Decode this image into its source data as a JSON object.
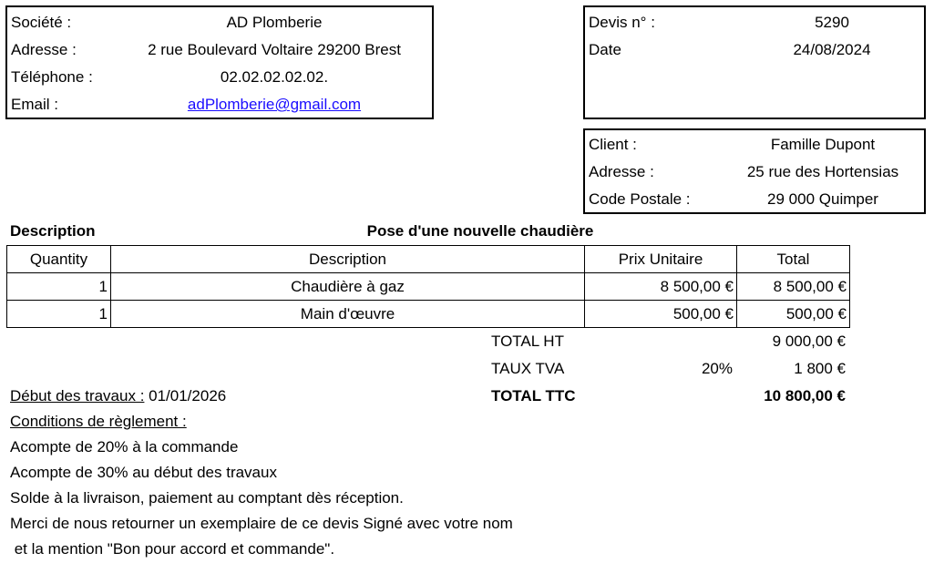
{
  "company": {
    "labels": {
      "societe": "Société :",
      "adresse": "Adresse :",
      "telephone": "Téléphone :",
      "email": "Email :"
    },
    "name": "AD Plomberie",
    "address": "2 rue Boulevard Voltaire  29200 Brest",
    "phone": "02.02.02.02.02.",
    "email": "adPlomberie@gmail.com"
  },
  "quote": {
    "labels": {
      "number": "Devis n° :",
      "date": "Date"
    },
    "number": "5290",
    "date": "24/08/2024"
  },
  "client": {
    "labels": {
      "client": "Client :",
      "adresse": "Adresse :",
      "postal": "Code Postale :"
    },
    "name": "Famille Dupont",
    "address": "25 rue des Hortensias",
    "postal": "29 000 Quimper"
  },
  "description": {
    "label": "Description",
    "title": "Pose d'une nouvelle chaudière"
  },
  "table": {
    "headers": [
      "Quantity",
      "Description",
      "Prix Unitaire",
      "Total"
    ],
    "rows": [
      [
        "1",
        "Chaudière à gaz",
        "8 500,00 €",
        "8 500,00 €"
      ],
      [
        "1",
        "Main d'œuvre",
        "500,00 €",
        "500,00 €"
      ]
    ]
  },
  "totals": {
    "ht_label": "TOTAL HT",
    "ht": "9 000,00 €",
    "tva_label": "TAUX TVA",
    "tva_rate": "20%",
    "tva": "1 800 €",
    "ttc_label": "TOTAL TTC",
    "ttc": "10 800,00 €"
  },
  "terms": {
    "start_label": "Début des travaux :",
    "start_date": " 01/01/2026",
    "conditions_label": "Conditions de règlement :",
    "lines": [
      "Acompte de 20% à la commande",
      "Acompte de 30% au début des travaux",
      "Solde à la livraison, paiement au comptant dès réception.",
      "Merci de nous retourner un exemplaire de ce devis Signé avec votre nom",
      " et la mention \"Bon pour accord et commande\"."
    ]
  }
}
